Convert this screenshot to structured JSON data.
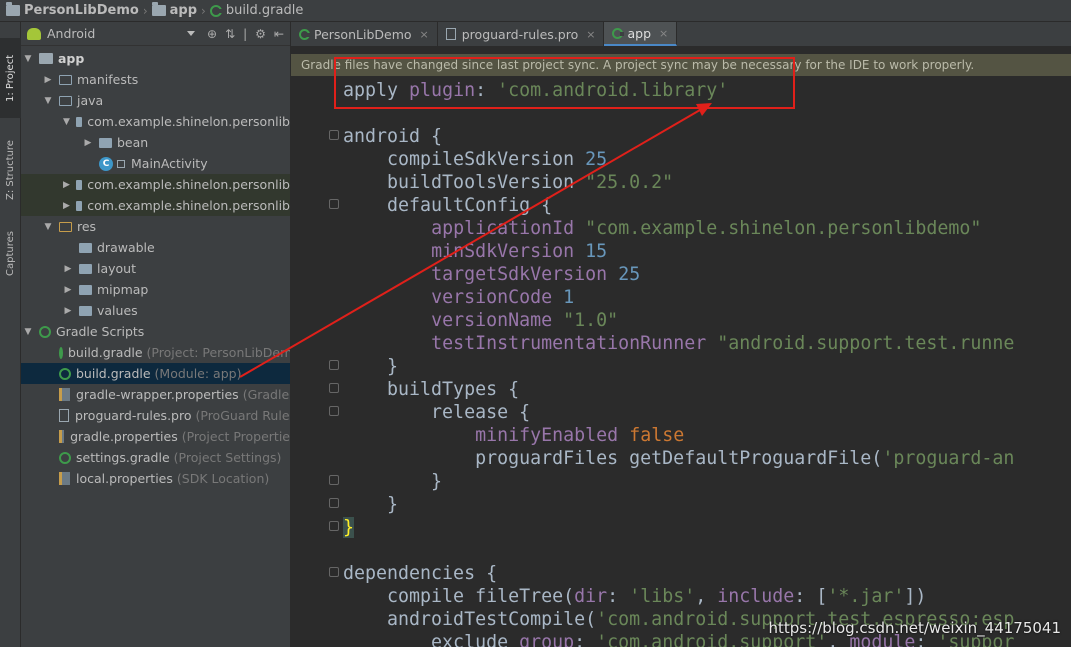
{
  "breadcrumb": {
    "items": [
      "PersonLibDemo",
      "app",
      "build.gradle"
    ]
  },
  "toolstrip": {
    "tabs": [
      "1: Project",
      "Z: Structure",
      "Captures"
    ]
  },
  "project_panel": {
    "view_selector": "Android",
    "tree": [
      {
        "label": "app",
        "sub": "",
        "bold": true
      },
      {
        "label": "manifests",
        "sub": ""
      },
      {
        "label": "java",
        "sub": ""
      },
      {
        "label": "com.example.shinelon.personlib",
        "sub": ""
      },
      {
        "label": "bean",
        "sub": ""
      },
      {
        "label": "MainActivity",
        "sub": ""
      },
      {
        "label": "com.example.shinelon.personlib",
        "sub": ""
      },
      {
        "label": "com.example.shinelon.personlib",
        "sub": ""
      },
      {
        "label": "res",
        "sub": ""
      },
      {
        "label": "drawable",
        "sub": ""
      },
      {
        "label": "layout",
        "sub": ""
      },
      {
        "label": "mipmap",
        "sub": ""
      },
      {
        "label": "values",
        "sub": ""
      },
      {
        "label": "Gradle Scripts",
        "sub": ""
      },
      {
        "label": "build.gradle",
        "sub": "(Project: PersonLibDem"
      },
      {
        "label": "build.gradle",
        "sub": "(Module: app)"
      },
      {
        "label": "gradle-wrapper.properties",
        "sub": "(Gradle"
      },
      {
        "label": "proguard-rules.pro",
        "sub": "(ProGuard Rule"
      },
      {
        "label": "gradle.properties",
        "sub": "(Project Propertie"
      },
      {
        "label": "settings.gradle",
        "sub": "(Project Settings)"
      },
      {
        "label": "local.properties",
        "sub": "(SDK Location)"
      }
    ]
  },
  "editor_tabs": [
    {
      "label": "PersonLibDemo",
      "close": "×"
    },
    {
      "label": "proguard-rules.pro",
      "close": "×"
    },
    {
      "label": "app",
      "close": "×",
      "active": true
    }
  ],
  "notice": {
    "text": "Gradle files have changed since last project sync. A project sync may be necessary for the IDE to work properly."
  },
  "code_lines": [
    "apply plugin: 'com.android.library'",
    "",
    "android {",
    "    compileSdkVersion 25",
    "    buildToolsVersion \"25.0.2\"",
    "    defaultConfig {",
    "        applicationId \"com.example.shinelon.personlibdemo\"",
    "        minSdkVersion 15",
    "        targetSdkVersion 25",
    "        versionCode 1",
    "        versionName \"1.0\"",
    "        testInstrumentationRunner \"android.support.test.runne",
    "    }",
    "    buildTypes {",
    "        release {",
    "            minifyEnabled false",
    "            proguardFiles getDefaultProguardFile('proguard-an",
    "        }",
    "    }",
    "}",
    "",
    "dependencies {",
    "    compile fileTree(dir: 'libs', include: ['*.jar'])",
    "    androidTestCompile('com.android.support.test.espresso:esp",
    "        exclude group: 'com.android.support', module: 'suppor"
  ],
  "watermark": "https://blog.csdn.net/weixin_44175041",
  "colors": {
    "annotation": "#e0201a",
    "selection": "#0d293e"
  }
}
